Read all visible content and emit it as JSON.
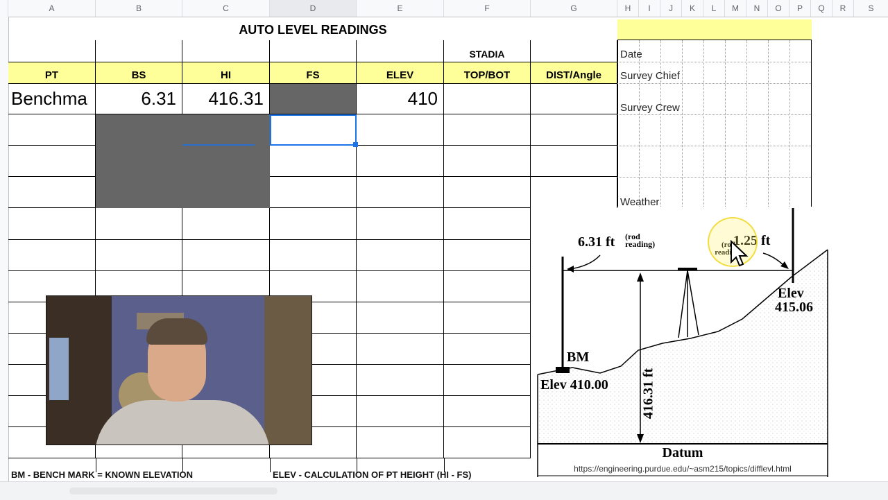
{
  "columns": [
    "A",
    "B",
    "C",
    "D",
    "E",
    "F",
    "G",
    "H",
    "I",
    "J",
    "K",
    "L",
    "M",
    "N",
    "O",
    "P",
    "Q",
    "R",
    "S"
  ],
  "title": "AUTO  LEVEL READINGS",
  "headers": {
    "pt": "PT",
    "bs": "BS",
    "hi": "HI",
    "fs": "FS",
    "elev": "ELEV",
    "stadia": "STADIA",
    "topbot": "TOP/BOT",
    "dist": "DIST/Angle"
  },
  "row1": {
    "pt": "Benchma",
    "bs": "6.31",
    "hi": "416.31",
    "elev": "410"
  },
  "side": {
    "date": "Date",
    "chief": "Survey Chief",
    "crew": "Survey Crew",
    "weather": "Weather"
  },
  "diagram": {
    "bs_label": "6.31 ft",
    "bs_note": "(rod\nreading)",
    "fs_label": "1.25 ft",
    "fs_note": "(rod reading)",
    "bm": "BM",
    "elev_bm": "Elev 410.00",
    "elev_pt_1": "Elev",
    "elev_pt_2": "415.06",
    "hi_vertical": "416.31 ft",
    "datum": "Datum",
    "url": "https://engineering.purdue.edu/~asm215/topics/difflevl.html"
  },
  "notes": {
    "bm": "BM - BENCH MARK = KNOWN ELEVATION",
    "elev": "ELEV - CALCULATION OF PT HEIGHT  (HI - FS)"
  },
  "colors": {
    "header_yellow": "#ffff99",
    "gray_fill": "#666666",
    "selection": "#1a73e8"
  }
}
